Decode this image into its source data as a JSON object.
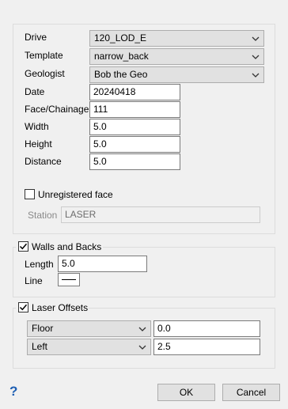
{
  "main": {
    "drive": {
      "label": "Drive",
      "value": "120_LOD_E"
    },
    "template": {
      "label": "Template",
      "value": "narrow_back"
    },
    "geologist": {
      "label": "Geologist",
      "value": "Bob the Geo"
    },
    "date": {
      "label": "Date",
      "value": "20240418"
    },
    "face_chainage": {
      "label": "Face/Chainage",
      "value": "111"
    },
    "width": {
      "label": "Width",
      "value": "5.0"
    },
    "height": {
      "label": "Height",
      "value": "5.0"
    },
    "distance": {
      "label": "Distance",
      "value": "5.0"
    },
    "unregistered_face": {
      "label": "Unregistered face",
      "checked": false
    },
    "station": {
      "label": "Station",
      "value": "LASER"
    }
  },
  "walls_and_backs": {
    "label": "Walls and Backs",
    "checked": true,
    "length": {
      "label": "Length",
      "value": "5.0"
    },
    "line": {
      "label": "Line"
    }
  },
  "laser_offsets": {
    "label": "Laser Offsets",
    "checked": true,
    "rows": [
      {
        "option": "Floor",
        "value": "0.0"
      },
      {
        "option": "Left",
        "value": "2.5"
      }
    ]
  },
  "footer": {
    "help": "?",
    "ok_label": "OK",
    "cancel_label": "Cancel"
  },
  "colors": {
    "help_icon": "#1e5fb3"
  }
}
